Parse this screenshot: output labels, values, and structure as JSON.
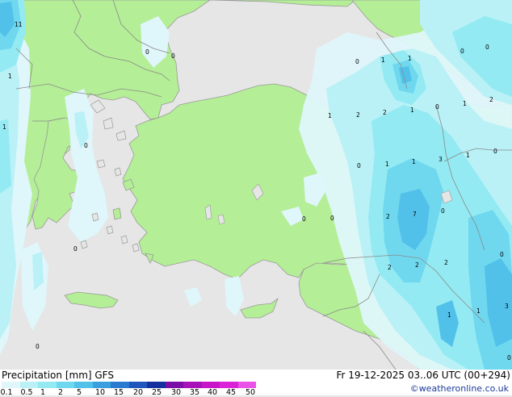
{
  "footer": {
    "title": "Precipitation [mm] GFS",
    "datetime": "Fr 19-12-2025 03..06 UTC (00+294)",
    "credit": "©weatheronline.co.uk"
  },
  "legend": {
    "labels": [
      "0.1",
      "0.5",
      "1",
      "2",
      "5",
      "10",
      "15",
      "20",
      "25",
      "30",
      "35",
      "40",
      "45",
      "50"
    ],
    "colors": [
      "#dff6fb",
      "#b9f1f6",
      "#93eaf2",
      "#6fd8ef",
      "#52c1ea",
      "#3a9fdf",
      "#2a7bd0",
      "#1e56bd",
      "#13309e",
      "#7c0ea8",
      "#a810b8",
      "#c814c8",
      "#dc22d8",
      "#ea52e8"
    ]
  },
  "colors": {
    "land": "#b4ee96",
    "sea": "#e6e6e6",
    "coast": "#9a9a9a",
    "border": "#8a8a8a"
  },
  "map_values": [
    "11",
    "1",
    "1",
    "0",
    "0",
    "0",
    "0",
    "1",
    "1",
    "2",
    "2",
    "1",
    "0",
    "1",
    "0",
    "1",
    "2",
    "0",
    "0",
    "1",
    "1",
    "3",
    "1",
    "0",
    "2",
    "7",
    "0",
    "0",
    "0",
    "2",
    "2",
    "2",
    "0",
    "1",
    "1",
    "3",
    "0",
    "0",
    "0"
  ]
}
